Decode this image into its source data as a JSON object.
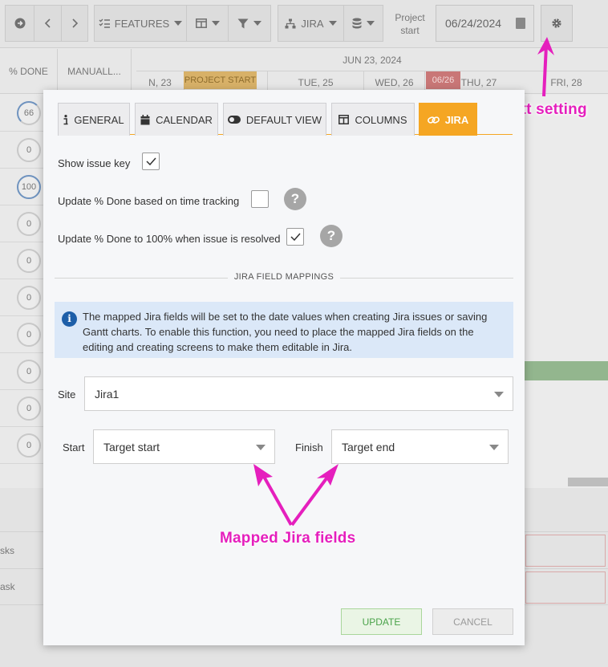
{
  "toolbar": {
    "features_label": "FEATURES",
    "jira_label": "JIRA",
    "project_start_label": "Project start",
    "project_start_date": "06/24/2024"
  },
  "grid": {
    "col_done": "% DONE",
    "col_manual": "MANUALL...",
    "week_label": "JUN 23, 2024",
    "days": [
      "N, 23",
      "TUE, 25",
      "WED, 26",
      "THU, 27",
      "FRI, 28"
    ],
    "project_start_tag": "PROJECT START",
    "today_tag": "06/26",
    "pct_values": [
      "66",
      "0",
      "100",
      "0",
      "0",
      "0",
      "0",
      "0",
      "0",
      "0"
    ],
    "bottom_rows": [
      "sks",
      "ask"
    ]
  },
  "annotations": {
    "gantt_setting": "Gantt setting",
    "mapped_fields": "Mapped Jira fields"
  },
  "modal": {
    "tabs": [
      {
        "label": "GENERAL",
        "icon": "info-icon"
      },
      {
        "label": "CALENDAR",
        "icon": "calendar-icon"
      },
      {
        "label": "DEFAULT VIEW",
        "icon": "toggle-icon"
      },
      {
        "label": "COLUMNS",
        "icon": "columns-icon"
      },
      {
        "label": "JIRA",
        "icon": "link-icon",
        "active": true
      }
    ],
    "options": {
      "show_issue_key": {
        "label": "Show issue key",
        "checked": true
      },
      "update_time_tracking": {
        "label": "Update % Done based on time tracking",
        "checked": false
      },
      "update_resolved": {
        "label": "Update % Done to 100% when issue is resolved",
        "checked": true
      }
    },
    "section_title": "JIRA FIELD MAPPINGS",
    "info_text": "The mapped Jira fields will be set to the date values when creating Jira issues or saving Gantt charts. To enable this function, you need to place the mapped Jira fields on the editing and creating screens to make them editable in Jira.",
    "site": {
      "label": "Site",
      "value": "Jira1"
    },
    "start": {
      "label": "Start",
      "value": "Target start"
    },
    "finish": {
      "label": "Finish",
      "value": "Target end"
    },
    "update_button": "UPDATE",
    "cancel_button": "CANCEL"
  },
  "colors": {
    "accent": "#f5a623",
    "annotation": "#e51fbd",
    "info_bg": "#dbe8f8",
    "update_text": "#4aa34a"
  }
}
